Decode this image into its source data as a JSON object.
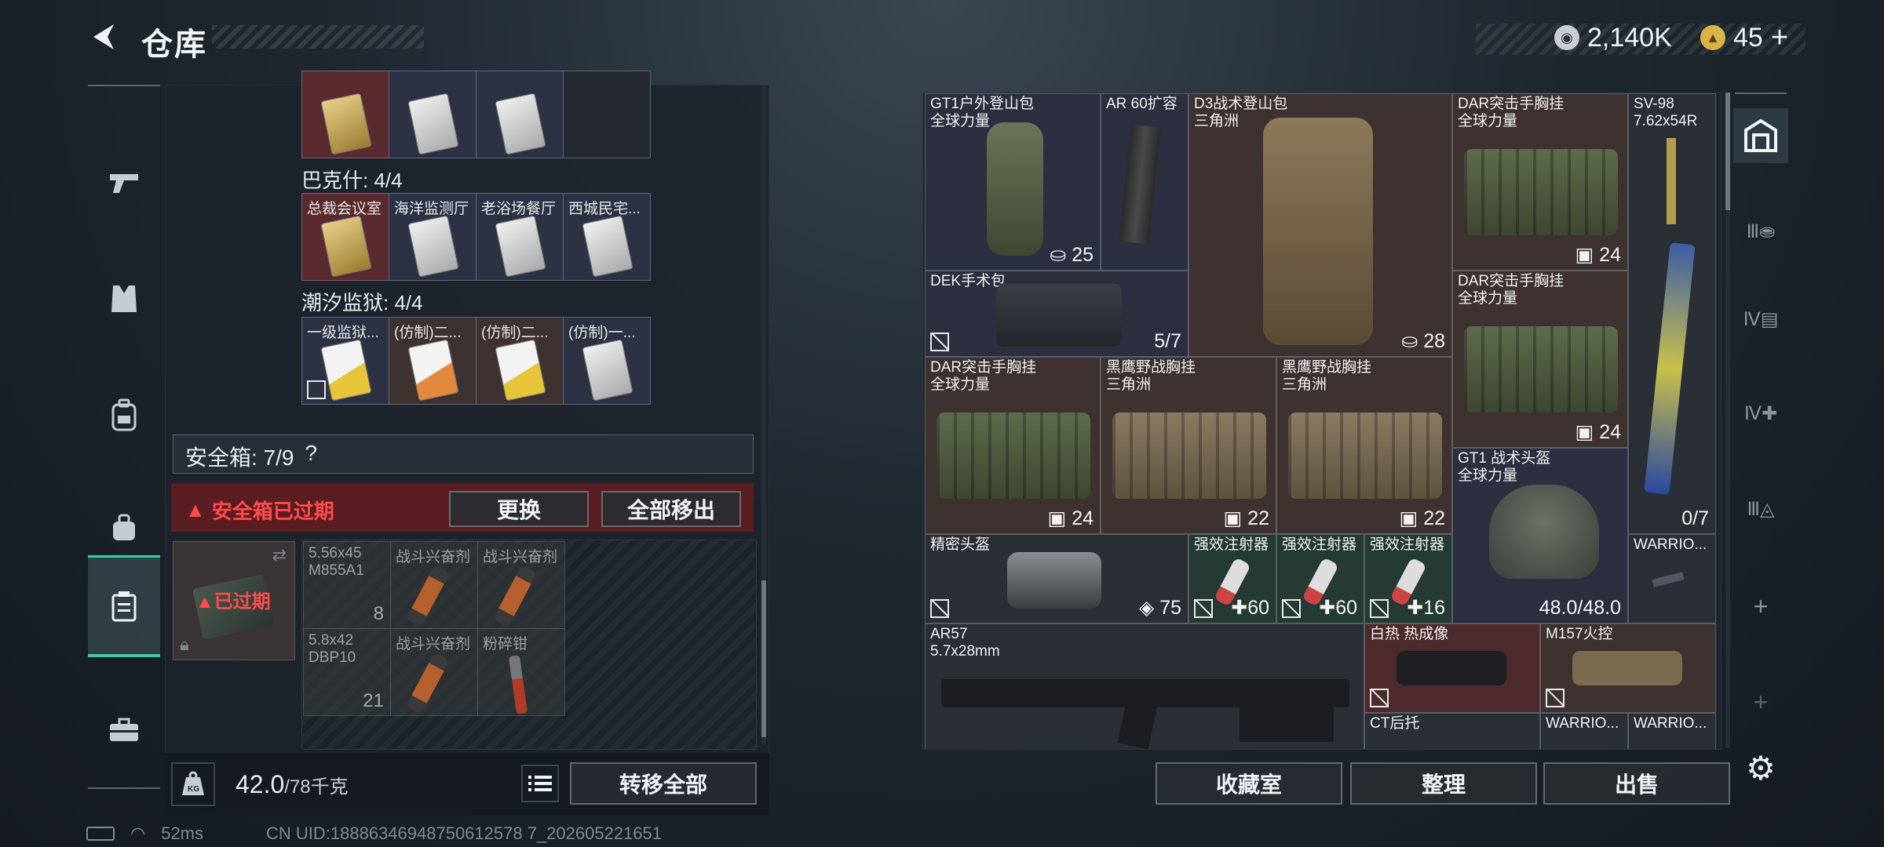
{
  "header": {
    "title": "仓库",
    "back_icon": "back-arrow-icon"
  },
  "currency": {
    "silver": "2,140K",
    "gold": "45",
    "gold_plus": "+",
    "colors": {
      "silver": "#c9ccd2",
      "gold": "#d9b348"
    }
  },
  "left_nav": [
    "pistol-icon",
    "vest-icon",
    "backpack-icon",
    "bag-icon",
    "safebox-icon",
    "toolbox-icon"
  ],
  "left_panel": {
    "top_row_cards": [
      "gold",
      "silver",
      "silver",
      "empty"
    ],
    "groups": [
      {
        "title": "巴克什: 4/4",
        "items": [
          "总裁会议室",
          "海洋监测厅",
          "老浴场餐厅",
          "西城民宅..."
        ]
      },
      {
        "title": "潮汐监狱: 4/4",
        "items": [
          "一级监狱...",
          "(仿制)二...",
          "(仿制)二...",
          "(仿制)一..."
        ]
      }
    ],
    "safebox": {
      "label": "安全箱: 7/9",
      "help": "?",
      "expired_warning": "安全箱已过期",
      "expired_badge": "已过期",
      "swap_button": "更换",
      "remove_all_button": "全部移出",
      "items": [
        {
          "name1": "5.56x45",
          "name2": "M855A1",
          "count": "8"
        },
        {
          "name1": "战斗兴奋剂",
          "name2": "",
          "count": ""
        },
        {
          "name1": "战斗兴奋剂",
          "name2": "",
          "count": ""
        },
        {
          "name1": "5.8x42",
          "name2": "DBP10",
          "count": "21"
        },
        {
          "name1": "战斗兴奋剂",
          "name2": "",
          "count": ""
        },
        {
          "name1": "粉碎钳",
          "name2": "",
          "count": ""
        }
      ]
    },
    "weight": {
      "value": "42.0",
      "max": "/78千克"
    },
    "transfer_all_button": "转移全部"
  },
  "stash_items": [
    {
      "id": "gt1",
      "name1": "GT1户外登山包",
      "name2": "全球力量",
      "count": "25"
    },
    {
      "id": "ar60",
      "name1": "AR 60扩容",
      "name2": "",
      "count": ""
    },
    {
      "id": "d3",
      "name1": "D3战术登山包",
      "name2": "三角洲",
      "count": "28"
    },
    {
      "id": "dar1",
      "name1": "DAR突击手胸挂",
      "name2": "全球力量",
      "count": "24"
    },
    {
      "id": "sv98",
      "name1": "SV-98",
      "name2": "7.62x54R",
      "count": "0/7"
    },
    {
      "id": "dek",
      "name1": "DEK手术包",
      "name2": "",
      "count": "5/7"
    },
    {
      "id": "dar2",
      "name1": "DAR突击手胸挂",
      "name2": "全球力量",
      "count": "24"
    },
    {
      "id": "dar3",
      "name1": "DAR突击手胸挂",
      "name2": "全球力量",
      "count": "24"
    },
    {
      "id": "hy1",
      "name1": "黑鹰野战胸挂",
      "name2": "三角洲",
      "count": "22"
    },
    {
      "id": "hy2",
      "name1": "黑鹰野战胸挂",
      "name2": "三角洲",
      "count": "22"
    },
    {
      "id": "gt1helm",
      "name1": "GT1 战术头盔",
      "name2": "全球力量",
      "count": "48.0/48.0"
    },
    {
      "id": "jm",
      "name1": "精密头盔",
      "name2": "",
      "count": "75"
    },
    {
      "id": "inj1",
      "name1": "强效注射器",
      "name2": "",
      "count": "60"
    },
    {
      "id": "inj2",
      "name1": "强效注射器",
      "name2": "",
      "count": "60"
    },
    {
      "id": "inj3",
      "name1": "强效注射器",
      "name2": "",
      "count": "16"
    },
    {
      "id": "warrior1",
      "name1": "WARRIO...",
      "name2": "",
      "count": ""
    },
    {
      "id": "ar57",
      "name1": "AR57",
      "name2": "5.7x28mm",
      "count": ""
    },
    {
      "id": "thermal",
      "name1": "白热 热成像",
      "name2": "",
      "count": ""
    },
    {
      "id": "m157",
      "name1": "M157火控",
      "name2": "",
      "count": ""
    },
    {
      "id": "ct",
      "name1": "CT后托",
      "name2": "",
      "count": ""
    },
    {
      "id": "warrior2",
      "name1": "WARRIO...",
      "name2": "",
      "count": ""
    },
    {
      "id": "warrior3",
      "name1": "WARRIO...",
      "name2": "",
      "count": ""
    }
  ],
  "right_tabs": [
    "stash-icon",
    "tab-iii-icon",
    "tab-iv-icon",
    "tab-iv-plus-icon",
    "tab-iii-2-icon",
    "add-tab-icon",
    "add-tab-icon"
  ],
  "right_buttons": {
    "collection": "收藏室",
    "sort": "整理",
    "sell": "出售"
  },
  "status": {
    "ping": "52ms",
    "uid": "CN UID:18886346948750612578 7_202605221651"
  },
  "colors": {
    "accent": "#2fd1a6",
    "warning": "#ff4b4b",
    "expired_bg": "#5a1e22"
  }
}
